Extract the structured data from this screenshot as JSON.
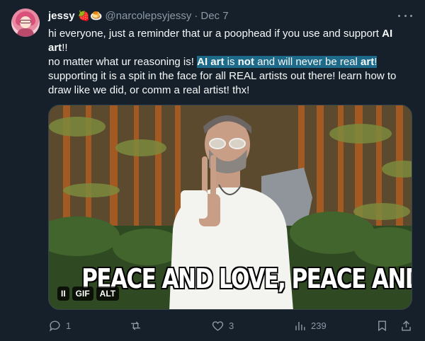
{
  "post": {
    "author_name": "jessy",
    "author_emojis": "🍓🍮",
    "handle": "@narcolepsyjessy",
    "separator": "·",
    "date": "Dec 7",
    "text": {
      "l1a": "hi everyone, just a reminder that ur a poophead if you use and support ",
      "l1b": "AI",
      "l2a": "art",
      "l2b": "!!",
      "l3a": "no matter what ur reasoning is! ",
      "h1": "AI art",
      "h2": " is ",
      "h3": "not",
      "h4": " and will never be real ",
      "h5": "art",
      "h6": "!",
      "l4": "supporting it is a spit in the face for all REAL artists out there! learn how to",
      "l5": "draw like we did, or comm a real artist! thx!"
    },
    "media": {
      "caption": "PEACE AND LOVE, PEACE AND LOVE",
      "pause_glyph": "II",
      "gif_badge": "GIF",
      "alt_badge": "ALT"
    },
    "actions": {
      "replies": "1",
      "reposts": "",
      "likes": "3",
      "views": "239"
    }
  },
  "icons": [
    "more-icon",
    "reply-icon",
    "repost-icon",
    "like-icon",
    "views-icon",
    "bookmark-icon",
    "share-icon",
    "pause-icon"
  ],
  "colors": {
    "background": "#15202b",
    "text": "#f7f9f9",
    "muted": "#8b98a5",
    "highlight": "#1d6a8a"
  }
}
